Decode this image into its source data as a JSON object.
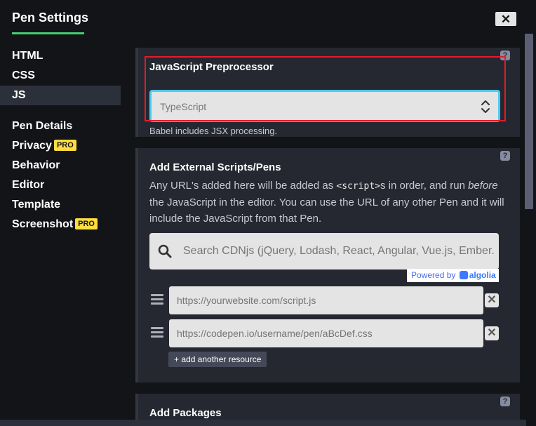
{
  "header": {
    "title": "Pen Settings",
    "close_label": "✕"
  },
  "sidebar": {
    "items": [
      {
        "label": "HTML",
        "active": false
      },
      {
        "label": "CSS",
        "active": false
      },
      {
        "label": "JS",
        "active": true
      },
      {
        "label": "Pen Details",
        "active": false
      },
      {
        "label": "Privacy",
        "badge": "PRO",
        "active": false
      },
      {
        "label": "Behavior",
        "active": false
      },
      {
        "label": "Editor",
        "active": false
      },
      {
        "label": "Template",
        "active": false
      },
      {
        "label": "Screenshot",
        "badge": "PRO",
        "active": false
      }
    ]
  },
  "preprocessor": {
    "title": "JavaScript Preprocessor",
    "selected": "TypeScript",
    "hint": "Babel includes JSX processing.",
    "help": "?"
  },
  "external": {
    "title": "Add External Scripts/Pens",
    "help": "?",
    "desc_part1": "Any URL's added here will be added as ",
    "desc_code": "<script>",
    "desc_part2": "s in order, and run ",
    "desc_em": "before",
    "desc_part3": " the JavaScript in the editor. You can use the URL of any other Pen and it will include the JavaScript from that Pen.",
    "search_placeholder": "Search CDNjs (jQuery, Lodash, React, Angular, Vue.js, Ember.",
    "powered_by": "Powered by",
    "powered_brand": "algolia",
    "resources": [
      {
        "placeholder": "https://yourwebsite.com/script.js"
      },
      {
        "placeholder": "https://codepen.io/username/pen/aBcDef.css"
      }
    ],
    "remove_label": "✕",
    "add_label": "+ add another resource"
  },
  "packages": {
    "title": "Add Packages",
    "help": "?"
  },
  "colors": {
    "background": "#131417",
    "panel": "#252830",
    "accent_green": "#47cf73",
    "focus_blue": "#4cc9f0",
    "highlight_red": "#e51b2a",
    "pro_yellow": "#ffdd40"
  }
}
